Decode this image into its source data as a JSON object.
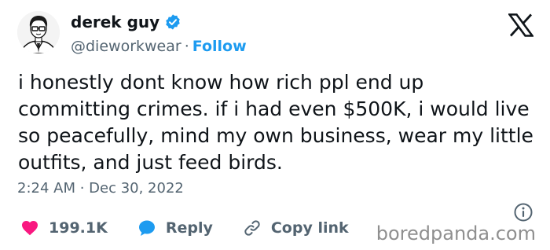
{
  "author": {
    "display_name": "derek guy",
    "handle": "@dieworkwear",
    "separator": "·",
    "follow_label": "Follow"
  },
  "tweet": {
    "text": "i honestly dont know how rich ppl end up committing crimes. if i had even $500K, i would live so peacefully, mind my own business, wear my little outfits, and just feed birds.",
    "timestamp": "2:24 AM · Dec 30, 2022"
  },
  "actions": {
    "likes": "199.1K",
    "reply_label": "Reply",
    "copy_link_label": "Copy link"
  },
  "watermark": "boredpanda.com",
  "colors": {
    "text": "#0f1419",
    "secondary": "#536471",
    "accent": "#1d9bf0",
    "like": "#f91880"
  },
  "icons": [
    "verified-badge-icon",
    "x-logo-icon",
    "info-icon",
    "heart-icon",
    "reply-bubble-icon",
    "link-icon"
  ]
}
